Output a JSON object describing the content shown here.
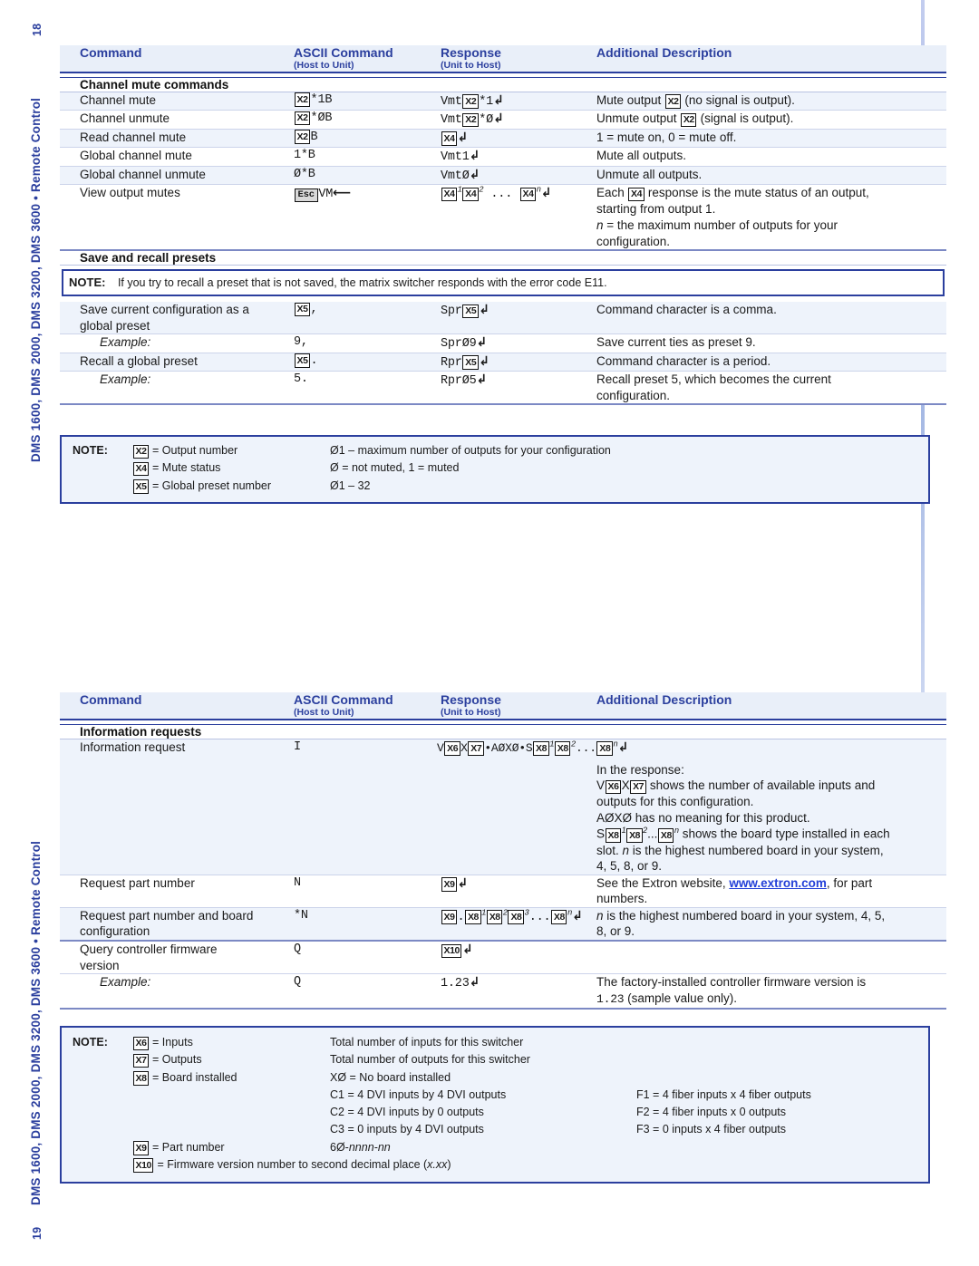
{
  "page": {
    "running_head": "DMS 1600, DMS 2000, DMS 3200, DMS 3600 • Remote Control",
    "page_top": "18",
    "page_bottom": "19"
  },
  "columns": {
    "command": "Command",
    "ascii": "ASCII Command",
    "ascii_sub": "(Host to Unit)",
    "response": "Response",
    "response_sub": "(Unit to Host)",
    "description": "Additional Description"
  },
  "table1": {
    "section1": "Channel mute commands",
    "rows1": [
      {
        "command": "Channel mute",
        "ascii": "X2*1B",
        "response": "VmtX2*1↵",
        "description": "Mute output X2 (no signal is output)."
      },
      {
        "command": "Channel unmute",
        "ascii": "X2*ØB",
        "response": "VmtX2*Ø↵",
        "description": "Unmute output X2 (signal is output)."
      },
      {
        "command": "Read channel mute",
        "ascii": "X2B",
        "response": "X4↵",
        "description": "1 = mute on, 0 = mute off."
      },
      {
        "command": "Global channel mute",
        "ascii": "1*B",
        "response": "Vmt1↵",
        "description": "Mute all outputs."
      },
      {
        "command": "Global channel unmute",
        "ascii": "Ø*B",
        "response": "VmtØ↵",
        "description": "Unmute all outputs."
      },
      {
        "command": "View output mutes",
        "ascii": "EscVM←",
        "response": "X4¹X4² ... X4ⁿ↵",
        "description_line1": "Each X4 response is the mute status of an output,",
        "description_line2": "starting from output 1.",
        "description_line3": "n = the maximum number of outputs for your",
        "description_line4": "configuration."
      }
    ],
    "section2": "Save and recall presets",
    "note_inline": {
      "label": "NOTE:",
      "text": "If you try to recall a preset that is not saved, the matrix switcher responds with the error code E11."
    },
    "rows2": [
      {
        "command_line1": "Save current configuration as a",
        "command_line2": "global preset",
        "ascii": "X5,",
        "response": "SprX5↵",
        "description": "Command character is a comma."
      },
      {
        "command": "Example:",
        "ascii": "9,",
        "response": "SprØ9↵",
        "description": "Save current ties as preset 9."
      },
      {
        "command": "Recall a global preset",
        "ascii": "X5.",
        "response": "RprX5↵",
        "description": "Command character is a period."
      },
      {
        "command": "Example:",
        "ascii": "5.",
        "response": "RprØ5↵",
        "description_line1": "Recall preset 5, which becomes the current",
        "description_line2": "configuration."
      }
    ],
    "note": {
      "label": "NOTE:",
      "entries": [
        {
          "var": "X2",
          "name": "= Output number",
          "value": "Ø1 – maximum number of outputs for your configuration"
        },
        {
          "var": "X4",
          "name": "= Mute status",
          "value": "Ø = not muted, 1 = muted"
        },
        {
          "var": "X5",
          "name": "= Global preset number",
          "value": "Ø1 – 32"
        }
      ]
    }
  },
  "table2": {
    "section1": "Information requests",
    "rows": [
      {
        "command": "Information request",
        "ascii": "I",
        "response": "VX6XX7•AØXØ•SX8¹X8²...X8ⁿ↵",
        "description_lines": [
          "In the response:",
          "VX6XX7 shows the number of available inputs and",
          "outputs for this configuration.",
          "AØXØ has no meaning for this product.",
          "SX8¹X8²...X8ⁿ shows the board type installed in each",
          "slot. n is the highest numbered board in your system,",
          "4, 5, 8, or 9."
        ]
      },
      {
        "command": "Request part number",
        "ascii": "N",
        "response": "X9↵",
        "description_pre": "See the Extron website, ",
        "description_link": "www.extron.com",
        "description_post": ", for part",
        "description_line2": "numbers."
      },
      {
        "command_line1": "Request part number and board",
        "command_line2": "configuration",
        "ascii": "*N",
        "response": "X9.X8¹X8²X8³...X8ⁿ↵",
        "description_line1": "n is the highest numbered board in your system, 4, 5,",
        "description_line2": "8, or 9."
      },
      {
        "command_line1": "Query controller firmware",
        "command_line2": "version",
        "ascii": "Q",
        "response": "X10↵",
        "description": ""
      },
      {
        "command": "Example:",
        "ascii": "Q",
        "response": "1.23↵",
        "description_line1": "The factory-installed controller firmware version is",
        "description_line2": "1.23 (sample value only)."
      }
    ],
    "note": {
      "label": "NOTE:",
      "entries": [
        {
          "var": "X6",
          "name": "= Inputs",
          "value": "Total number of inputs for this switcher",
          "value2": ""
        },
        {
          "var": "X7",
          "name": "= Outputs",
          "value": "Total number of outputs for this switcher",
          "value2": ""
        },
        {
          "var": "X8",
          "name": "= Board installed",
          "value": "XØ = No board installed",
          "value2": ""
        },
        {
          "var": "",
          "name": "",
          "value": "C1 = 4 DVI inputs by 4 DVI outputs",
          "value2": "F1 = 4 fiber inputs x 4 fiber outputs"
        },
        {
          "var": "",
          "name": "",
          "value": "C2 = 4 DVI inputs by 0 outputs",
          "value2": "F2 = 4 fiber inputs x 0 outputs"
        },
        {
          "var": "",
          "name": "",
          "value": "C3 = 0 inputs by 4 DVI outputs",
          "value2": "F3 = 0 inputs x 4 fiber outputs"
        },
        {
          "var": "X9",
          "name": "= Part number",
          "value": "60-nnnn-nn",
          "value2": ""
        }
      ],
      "last_var": "X10",
      "last_text": "= Firmware version number to second decimal place (x.xx)"
    }
  },
  "colors": {
    "heading_blue": "#2b3f9e",
    "link_blue": "#2340d8",
    "row_tint": "#eef3fb",
    "header_bg": "#e9eff9"
  }
}
